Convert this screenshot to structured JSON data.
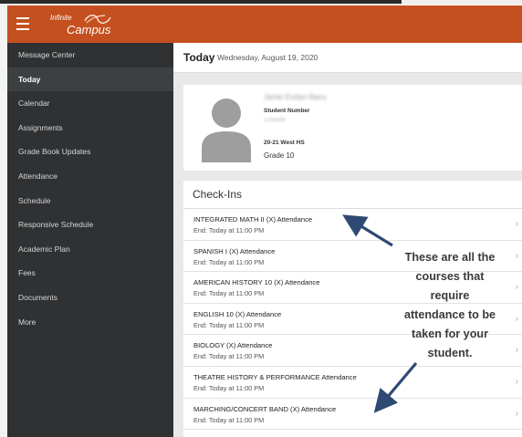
{
  "header": {
    "logo_top": "Infinite",
    "logo_bottom": "Campus",
    "bg_color": "#c5501f"
  },
  "sidebar": {
    "items": [
      {
        "label": "Message Center",
        "active": false
      },
      {
        "label": "Today",
        "active": true
      },
      {
        "label": "Calendar",
        "active": false
      },
      {
        "label": "Assignments",
        "active": false
      },
      {
        "label": "Grade Book Updates",
        "active": false
      },
      {
        "label": "Attendance",
        "active": false
      },
      {
        "label": "Schedule",
        "active": false
      },
      {
        "label": "Responsive Schedule",
        "active": false
      },
      {
        "label": "Academic Plan",
        "active": false
      },
      {
        "label": "Fees",
        "active": false
      },
      {
        "label": "Documents",
        "active": false
      },
      {
        "label": "More",
        "active": false
      }
    ]
  },
  "main": {
    "page_title": "Today",
    "date": "Wednesday, August 19, 2020",
    "student": {
      "name": "Jamie Evelyn Barry",
      "student_number_label": "Student Number",
      "student_number": "1234568",
      "school": "20-21 West HS",
      "grade": "Grade 10"
    },
    "checkins": {
      "title": "Check-Ins",
      "items": [
        {
          "name": "INTEGRATED MATH II (X) Attendance",
          "end": "End: Today at 11:00 PM"
        },
        {
          "name": "SPANISH I (X) Attendance",
          "end": "End: Today at 11:00 PM"
        },
        {
          "name": "AMERICAN HISTORY 10 (X) Attendance",
          "end": "End: Today at 11:00 PM"
        },
        {
          "name": "ENGLISH 10 (X) Attendance",
          "end": "End: Today at 11:00 PM"
        },
        {
          "name": "BIOLOGY (X) Attendance",
          "end": "End: Today at 11:00 PM"
        },
        {
          "name": "THEATRE HISTORY & PERFORMANCE Attendance",
          "end": "End: Today at 11:00 PM"
        },
        {
          "name": "MARCHING/CONCERT BAND (X) Attendance",
          "end": "End: Today at 11:00 PM"
        }
      ]
    }
  },
  "annotation": {
    "lines": [
      "These are all the",
      "courses that",
      "require",
      "attendance to be",
      "taken for your",
      "student."
    ]
  },
  "icons": {
    "menu": "hamburger-icon",
    "avatar": "person-silhouette-icon",
    "row_chevron": "chevron-right-icon",
    "arrows": "arrow-icon"
  }
}
